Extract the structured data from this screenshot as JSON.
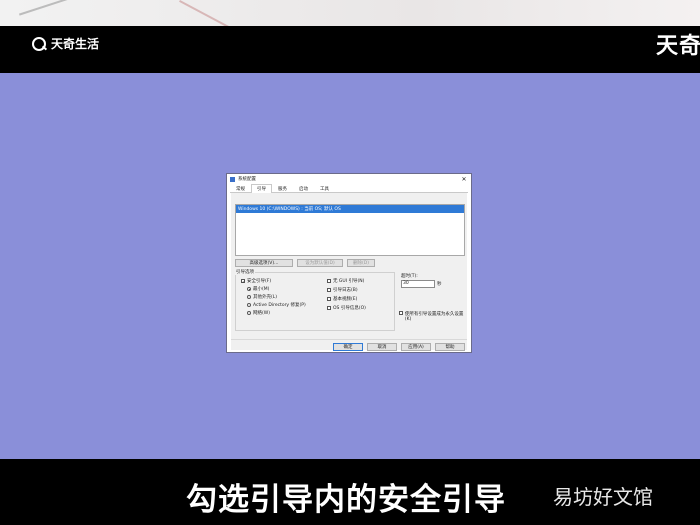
{
  "header": {
    "logo_text": "天奇生活",
    "brand_partial": "天奇"
  },
  "caption": "勾选引导内的安全引导",
  "watermark": "易坊好文馆",
  "dialog": {
    "title": "系统配置",
    "close": "✕",
    "tabs": [
      "常规",
      "引导",
      "服务",
      "启动",
      "工具"
    ],
    "active_tab": 1,
    "os_entry": "Windows 10 (C:\\WINDOWS) : 当前 OS; 默认 OS",
    "buttons": {
      "advanced": "高级选项(V)...",
      "set_default": "设为默认值(D)",
      "delete": "删除(D)",
      "ok": "确定",
      "cancel": "取消",
      "apply": "应用(A)",
      "help": "帮助"
    },
    "boot_options_label": "引导选项",
    "safe_boot": "安全引导(F)",
    "radios": [
      "最小(M)",
      "其他外壳(L)",
      "Active Directory 修复(P)",
      "网络(W)"
    ],
    "checks_right": [
      "无 GUI 引导(N)",
      "引导日志(B)",
      "基本视频(E)",
      "OS 引导信息(O)"
    ],
    "timeout_label": "超时(T):",
    "timeout_value": "30",
    "timeout_unit": "秒",
    "permanent": "使所有引导设置成为永久设置(K)"
  }
}
